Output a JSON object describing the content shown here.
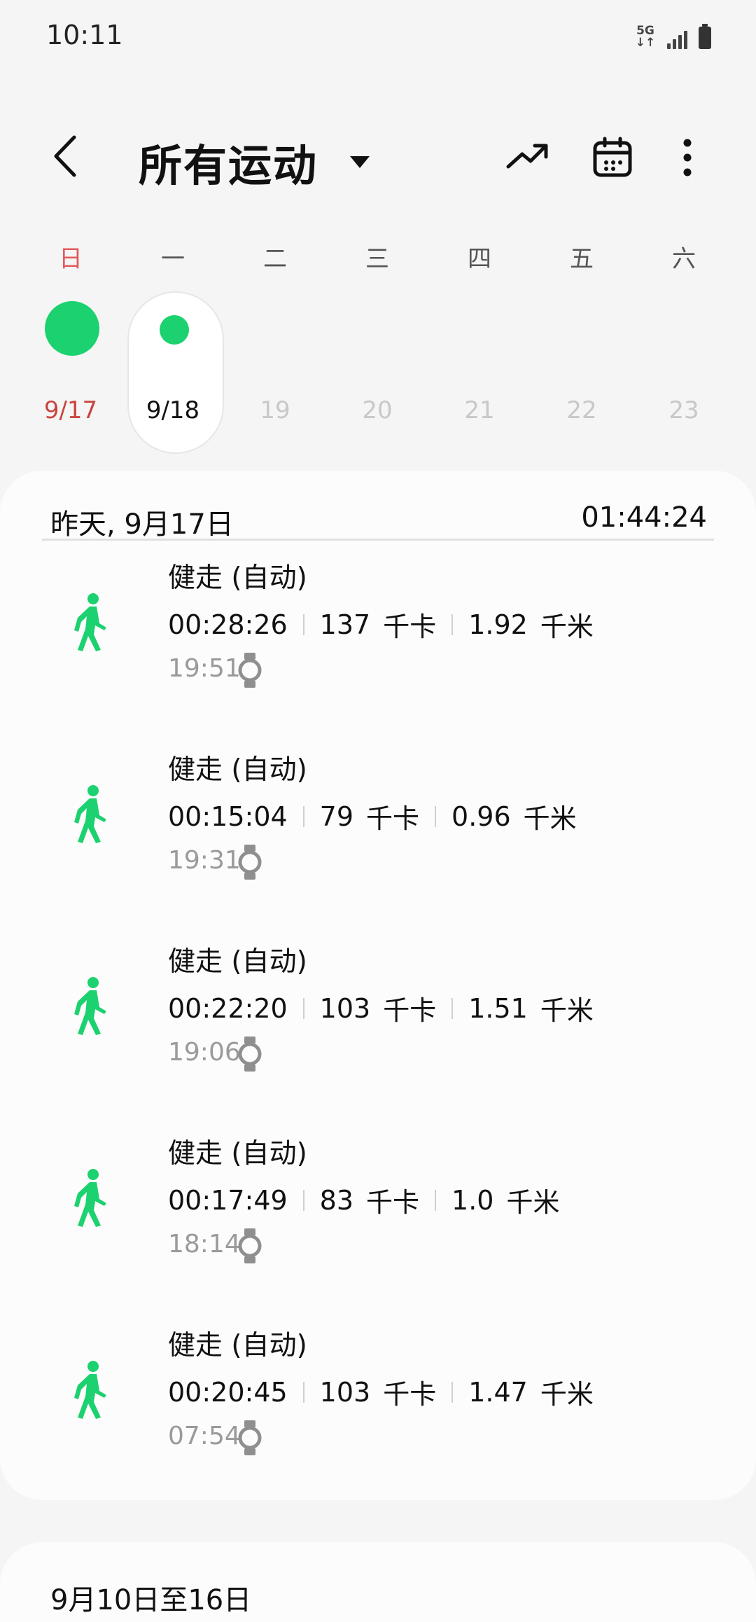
{
  "status": {
    "time": "10:11",
    "network": "5G"
  },
  "header": {
    "title": "所有运动"
  },
  "week": {
    "labels": [
      "日",
      "一",
      "二",
      "三",
      "四",
      "五",
      "六"
    ],
    "dates": [
      "9/17",
      "9/18",
      "19",
      "20",
      "21",
      "22",
      "23"
    ],
    "selected": "9/18"
  },
  "day_section": {
    "date": "昨天, 9月17日",
    "total": "01:44:24"
  },
  "entries": [
    {
      "title": "健走 (自动)",
      "duration": "00:28:26",
      "calories": "137",
      "cal_unit": "千卡",
      "distance": "1.92",
      "dist_unit": "千米",
      "time": "19:51"
    },
    {
      "title": "健走 (自动)",
      "duration": "00:15:04",
      "calories": "79",
      "cal_unit": "千卡",
      "distance": "0.96",
      "dist_unit": "千米",
      "time": "19:31"
    },
    {
      "title": "健走 (自动)",
      "duration": "00:22:20",
      "calories": "103",
      "cal_unit": "千卡",
      "distance": "1.51",
      "dist_unit": "千米",
      "time": "19:06"
    },
    {
      "title": "健走 (自动)",
      "duration": "00:17:49",
      "calories": "83",
      "cal_unit": "千卡",
      "distance": "1.0",
      "dist_unit": "千米",
      "time": "18:14"
    },
    {
      "title": "健走 (自动)",
      "duration": "00:20:45",
      "calories": "103",
      "cal_unit": "千卡",
      "distance": "1.47",
      "dist_unit": "千米",
      "time": "07:54"
    }
  ],
  "next_section": {
    "title": "9月10日至16日"
  },
  "colors": {
    "accent": "#1cd16f",
    "sunday": "#e25b5b"
  },
  "icons": {
    "back": "chevron-left-icon",
    "dropdown": "caret-down-icon",
    "trend": "trend-icon",
    "calendar": "calendar-icon",
    "more": "more-vertical-icon",
    "workout": "walking-icon",
    "device": "watch-icon"
  }
}
